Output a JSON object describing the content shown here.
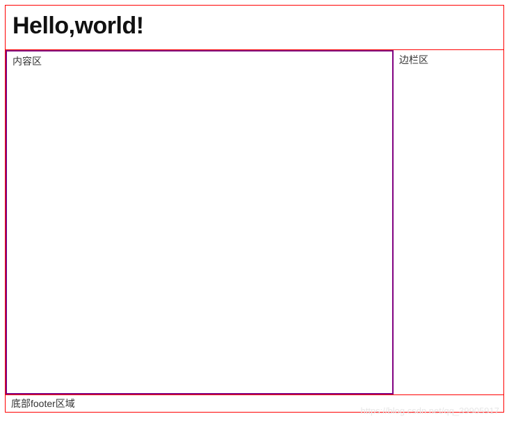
{
  "header": {
    "title": "Hello,world!"
  },
  "main": {
    "label": "内容区"
  },
  "aside": {
    "label": "边栏区"
  },
  "footer": {
    "label": "底部footer区域"
  },
  "watermark": "https://blog.csdn.net/qq_39905917"
}
